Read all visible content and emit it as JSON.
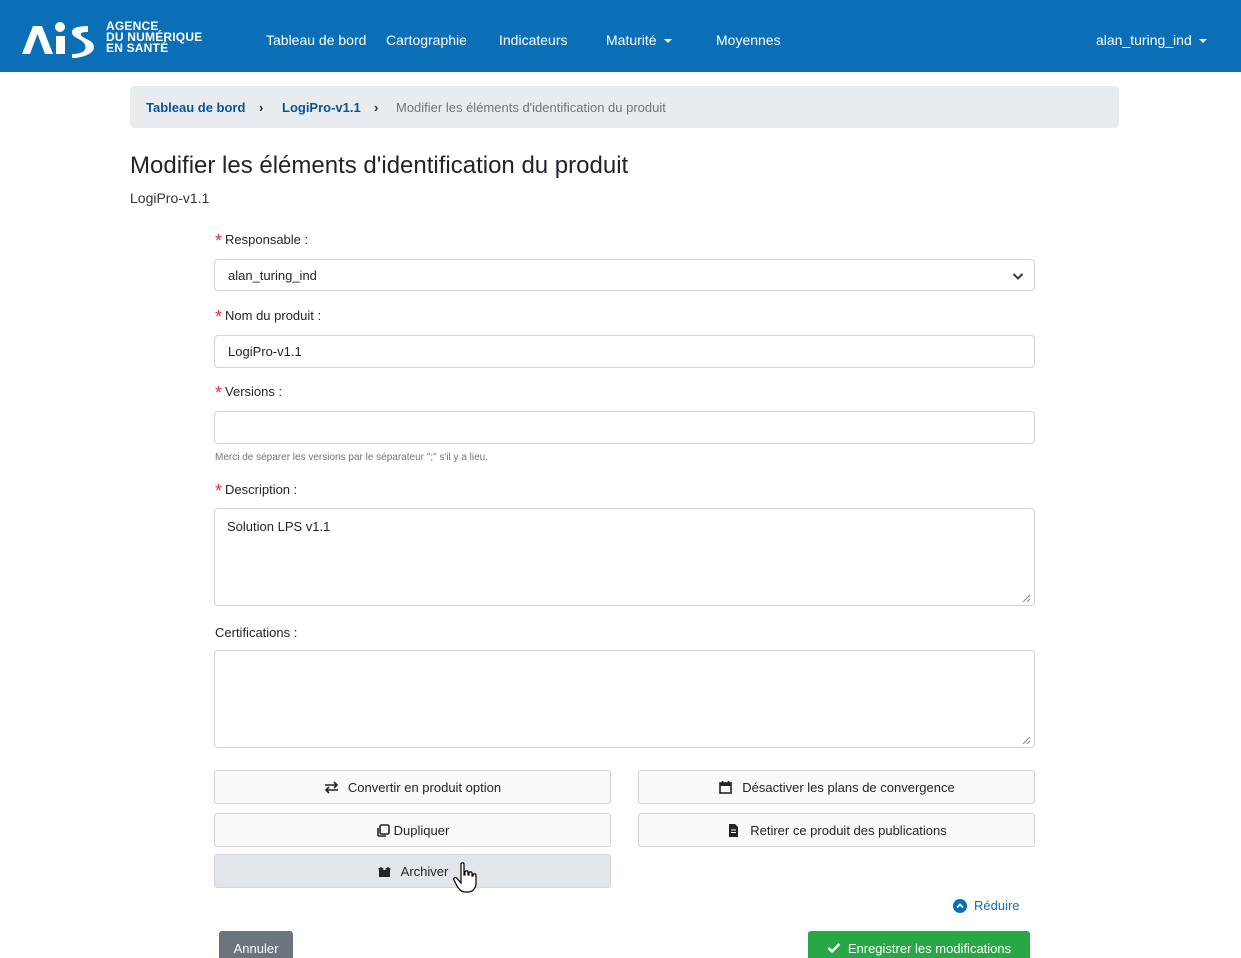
{
  "navbar": {
    "logo_lines": [
      "AGENCE",
      "DU NUMÉRIQUE",
      "EN SANTÉ"
    ],
    "items": [
      {
        "label": "Tableau de bord"
      },
      {
        "label": "Cartographie"
      },
      {
        "label": "Indicateurs"
      },
      {
        "label": "Maturité",
        "dropdown": true
      },
      {
        "label": "Moyennes"
      }
    ],
    "user": "alan_turing_ind",
    "color": "#0b6fb8"
  },
  "breadcrumb": {
    "items": [
      "Tableau de bord",
      "LogiPro-v1.1"
    ],
    "current": "Modifier les éléments d'identification du produit"
  },
  "page": {
    "title": "Modifier les éléments d'identification du produit",
    "subtitle": "LogiPro-v1.1"
  },
  "form": {
    "required_mark": "*",
    "responsable": {
      "label": "Responsable :",
      "value": "alan_turing_ind"
    },
    "nom": {
      "label": "Nom du produit :",
      "value": "LogiPro-v1.1"
    },
    "versions": {
      "label": "Versions :",
      "value": "",
      "help": "Merci de séparer les versions par le séparateur \";\" s'il y a lieu."
    },
    "description": {
      "label": "Description :",
      "value": "Solution LPS v1.1"
    },
    "certifications": {
      "label": "Certifications :",
      "value": ""
    }
  },
  "actions": {
    "convert": "Convertir en produit option",
    "deactivate": "Désactiver les plans de convergence",
    "duplicate": "Dupliquer",
    "withdraw": "Retirer ce produit des publications",
    "archive": "Archiver",
    "collapse": "Réduire",
    "cancel": "Annuler",
    "save": "Enregistrer les modifications"
  },
  "colors": {
    "primary": "#0b6fb8",
    "required": "#dc3545",
    "success": "#28a745",
    "secondary": "#6c757d"
  }
}
